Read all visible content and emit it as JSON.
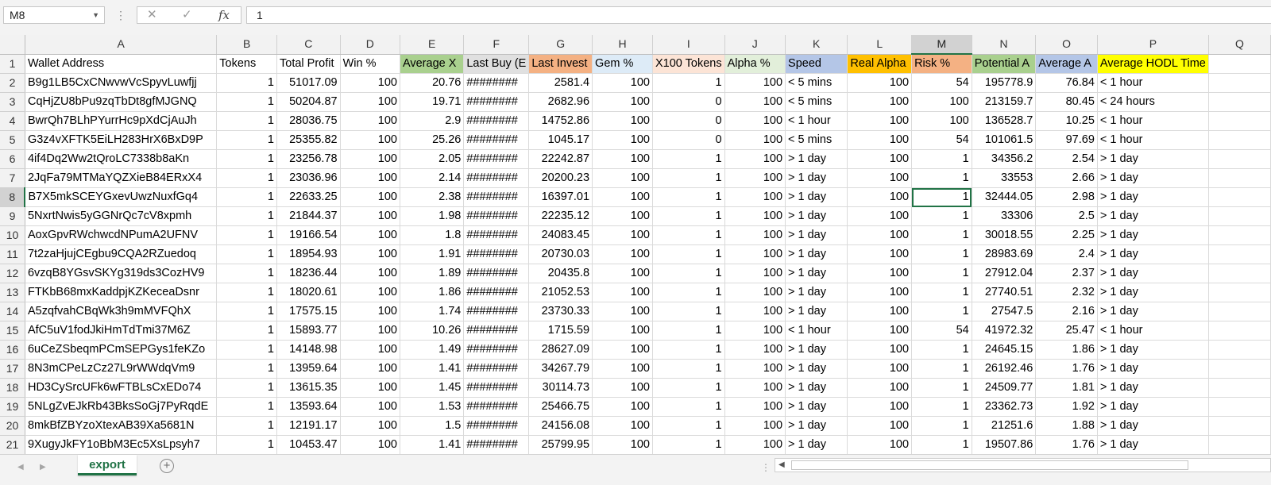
{
  "name_box": "M8",
  "formula_bar": {
    "fx_label": "fx",
    "value": "1"
  },
  "columns": [
    "A",
    "B",
    "C",
    "D",
    "E",
    "F",
    "G",
    "H",
    "I",
    "J",
    "K",
    "L",
    "M",
    "N",
    "O",
    "P",
    "Q"
  ],
  "selected_column": "M",
  "selected_row": 8,
  "header_colors": {
    "E": "#a9d08e",
    "F": "#e0e0e0",
    "G": "#f4b183",
    "H": "#ddebf7",
    "I": "#fce4d6",
    "J": "#e2efda",
    "K": "#b4c6e7",
    "L": "#ffc000",
    "M": "#f4b183",
    "N": "#a9d08e",
    "O": "#b4c6e7",
    "P": "#ffff00"
  },
  "headers": [
    "Wallet Address",
    "Tokens",
    "Total Profit",
    "Win %",
    "Average X",
    "Last Buy (E",
    "Last Invest",
    "Gem %",
    "X100 Tokens",
    "Alpha %",
    "Speed",
    "Real Alpha",
    "Risk %",
    "Potential A",
    "Average A",
    "Average HODL Time",
    ""
  ],
  "rows": [
    [
      "B9g1LB5CxCNwvwVcSpyvLuwfjj",
      "1",
      "51017.09",
      "100",
      "20.76",
      "########",
      "2581.4",
      "100",
      "1",
      "100",
      "< 5 mins",
      "100",
      "54",
      "195778.9",
      "76.84",
      "< 1 hour"
    ],
    [
      "CqHjZU8bPu9zqTbDt8gfMJGNQ",
      "1",
      "50204.87",
      "100",
      "19.71",
      "########",
      "2682.96",
      "100",
      "0",
      "100",
      "< 5 mins",
      "100",
      "100",
      "213159.7",
      "80.45",
      "< 24 hours"
    ],
    [
      "BwrQh7BLhPYurrHc9pXdCjAuJh",
      "1",
      "28036.75",
      "100",
      "2.9",
      "########",
      "14752.86",
      "100",
      "0",
      "100",
      "< 1 hour",
      "100",
      "100",
      "136528.7",
      "10.25",
      "< 1 hour"
    ],
    [
      "G3z4vXFTK5EiLH283HrX6BxD9P",
      "1",
      "25355.82",
      "100",
      "25.26",
      "########",
      "1045.17",
      "100",
      "0",
      "100",
      "< 5 mins",
      "100",
      "54",
      "101061.5",
      "97.69",
      "< 1 hour"
    ],
    [
      "4if4Dq2Ww2tQroLC7338b8aKn",
      "1",
      "23256.78",
      "100",
      "2.05",
      "########",
      "22242.87",
      "100",
      "1",
      "100",
      "> 1 day",
      "100",
      "1",
      "34356.2",
      "2.54",
      "> 1 day"
    ],
    [
      "2JqFa79MTMaYQZXieB84ERxX4",
      "1",
      "23036.96",
      "100",
      "2.14",
      "########",
      "20200.23",
      "100",
      "1",
      "100",
      "> 1 day",
      "100",
      "1",
      "33553",
      "2.66",
      "> 1 day"
    ],
    [
      "B7X5mkSCEYGxevUwzNuxfGq4",
      "1",
      "22633.25",
      "100",
      "2.38",
      "########",
      "16397.01",
      "100",
      "1",
      "100",
      "> 1 day",
      "100",
      "1",
      "32444.05",
      "2.98",
      "> 1 day"
    ],
    [
      "5NxrtNwis5yGGNrQc7cV8xpmh",
      "1",
      "21844.37",
      "100",
      "1.98",
      "########",
      "22235.12",
      "100",
      "1",
      "100",
      "> 1 day",
      "100",
      "1",
      "33306",
      "2.5",
      "> 1 day"
    ],
    [
      "AoxGpvRWchwcdNPumA2UFNV",
      "1",
      "19166.54",
      "100",
      "1.8",
      "########",
      "24083.45",
      "100",
      "1",
      "100",
      "> 1 day",
      "100",
      "1",
      "30018.55",
      "2.25",
      "> 1 day"
    ],
    [
      "7t2zaHjujCEgbu9CQA2RZuedoq",
      "1",
      "18954.93",
      "100",
      "1.91",
      "########",
      "20730.03",
      "100",
      "1",
      "100",
      "> 1 day",
      "100",
      "1",
      "28983.69",
      "2.4",
      "> 1 day"
    ],
    [
      "6vzqB8YGsvSKYg319ds3CozHV9",
      "1",
      "18236.44",
      "100",
      "1.89",
      "########",
      "20435.8",
      "100",
      "1",
      "100",
      "> 1 day",
      "100",
      "1",
      "27912.04",
      "2.37",
      "> 1 day"
    ],
    [
      "FTKbB68mxKaddpjKZKeceaDsnr",
      "1",
      "18020.61",
      "100",
      "1.86",
      "########",
      "21052.53",
      "100",
      "1",
      "100",
      "> 1 day",
      "100",
      "1",
      "27740.51",
      "2.32",
      "> 1 day"
    ],
    [
      "A5zqfvahCBqWk3h9mMVFQhX",
      "1",
      "17575.15",
      "100",
      "1.74",
      "########",
      "23730.33",
      "100",
      "1",
      "100",
      "> 1 day",
      "100",
      "1",
      "27547.5",
      "2.16",
      "> 1 day"
    ],
    [
      "AfC5uV1fodJkiHmTdTmi37M6Z",
      "1",
      "15893.77",
      "100",
      "10.26",
      "########",
      "1715.59",
      "100",
      "1",
      "100",
      "< 1 hour",
      "100",
      "54",
      "41972.32",
      "25.47",
      "< 1 hour"
    ],
    [
      "6uCeZSbeqmPCmSEPGys1feKZo",
      "1",
      "14148.98",
      "100",
      "1.49",
      "########",
      "28627.09",
      "100",
      "1",
      "100",
      "> 1 day",
      "100",
      "1",
      "24645.15",
      "1.86",
      "> 1 day"
    ],
    [
      "8N3mCPeLzCz27L9rWWdqVm9",
      "1",
      "13959.64",
      "100",
      "1.41",
      "########",
      "34267.79",
      "100",
      "1",
      "100",
      "> 1 day",
      "100",
      "1",
      "26192.46",
      "1.76",
      "> 1 day"
    ],
    [
      "HD3CySrcUFk6wFTBLsCxEDo74",
      "1",
      "13615.35",
      "100",
      "1.45",
      "########",
      "30114.73",
      "100",
      "1",
      "100",
      "> 1 day",
      "100",
      "1",
      "24509.77",
      "1.81",
      "> 1 day"
    ],
    [
      "5NLgZvEJkRb43BksSoGj7PyRqdE",
      "1",
      "13593.64",
      "100",
      "1.53",
      "########",
      "25466.75",
      "100",
      "1",
      "100",
      "> 1 day",
      "100",
      "1",
      "23362.73",
      "1.92",
      "> 1 day"
    ],
    [
      "8mkBfZBYzoXtexAB39Xa5681N",
      "1",
      "12191.17",
      "100",
      "1.5",
      "########",
      "24156.08",
      "100",
      "1",
      "100",
      "> 1 day",
      "100",
      "1",
      "21251.6",
      "1.88",
      "> 1 day"
    ],
    [
      "9XugyJkFY1oBbM3Ec5XsLpsyh7",
      "1",
      "10453.47",
      "100",
      "1.41",
      "########",
      "25799.95",
      "100",
      "1",
      "100",
      "> 1 day",
      "100",
      "1",
      "19507.86",
      "1.76",
      "> 1 day"
    ]
  ],
  "sheet_tab": "export",
  "icons": {
    "cancel": "close-icon",
    "confirm": "check-icon",
    "function": "fx-icon",
    "add_sheet": "plus-icon"
  }
}
